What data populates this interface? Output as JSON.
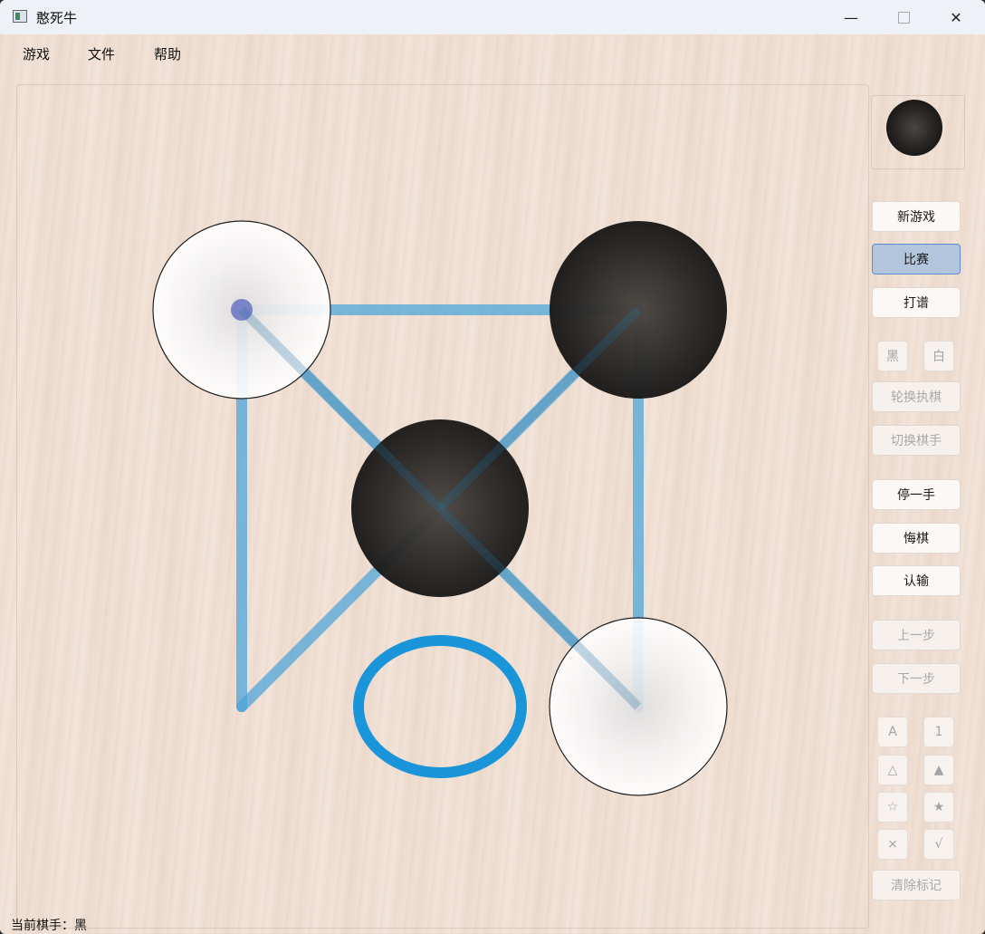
{
  "window": {
    "title": "憨死牛"
  },
  "menu": [
    "游戏",
    "文件",
    "帮助"
  ],
  "buttons": {
    "new_game": "新游戏",
    "match": "比赛",
    "record": "打谱",
    "black": "黑",
    "white": "白",
    "rotate": "轮换执棋",
    "switch_player": "切换棋手",
    "pass": "停一手",
    "undo": "悔棋",
    "resign": "认输",
    "prev_step": "上一步",
    "next_step": "下一步",
    "mark_a": "A",
    "mark_1": "1",
    "mark_triangle": "△",
    "mark_triangle_filled": "▲",
    "mark_star": "☆",
    "mark_star_filled": "★",
    "mark_cross": "×",
    "mark_check": "√",
    "clear_marks": "清除标记"
  },
  "current_turn_indicator": "black",
  "status": "当前棋手：黑",
  "board": {
    "points": [
      "top-left",
      "top-right",
      "center",
      "bottom-left",
      "bottom-right"
    ],
    "stones": [
      {
        "point": "top-left",
        "color": "white"
      },
      {
        "point": "top-right",
        "color": "black"
      },
      {
        "point": "center",
        "color": "black"
      },
      {
        "point": "bottom-right",
        "color": "white"
      }
    ],
    "last_move_marker": "top-left",
    "selected_point": "bottom-left",
    "colors": {
      "line": "#4aa3db",
      "selection_ring": "#1b95d9",
      "marker": "#7b83c8"
    }
  }
}
